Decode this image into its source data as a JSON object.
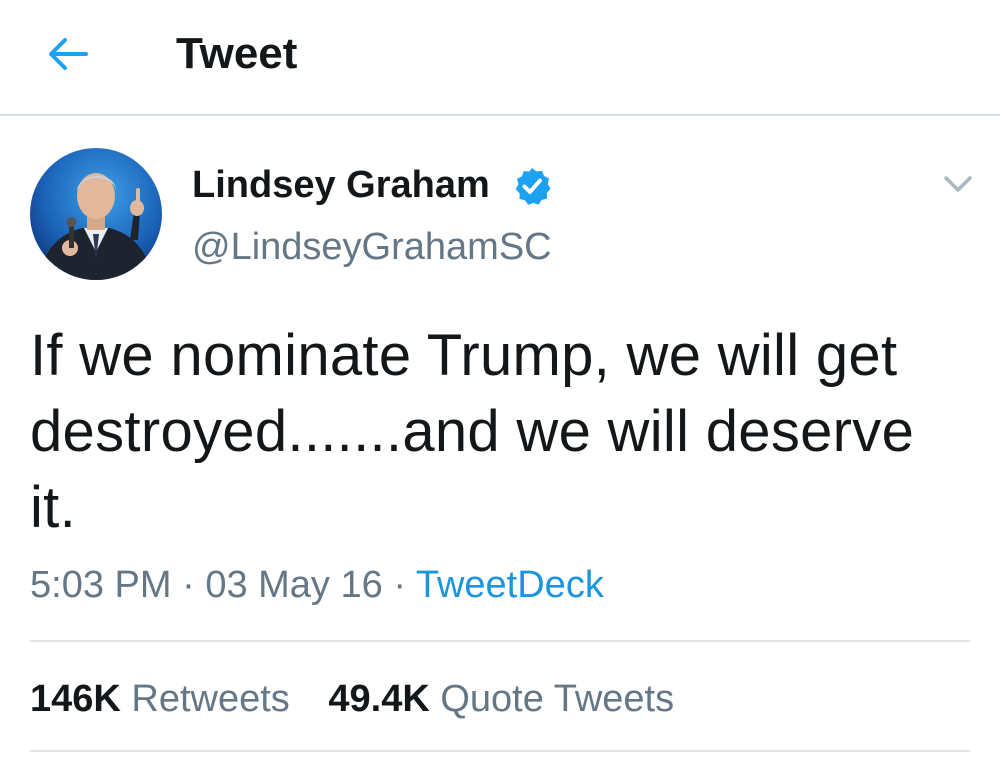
{
  "header": {
    "title": "Tweet",
    "back_icon": "arrow-left-icon",
    "accent": "#1da1f2"
  },
  "tweet": {
    "author": {
      "name": "Lindsey Graham",
      "handle": "@LindseyGrahamSC",
      "verified": true,
      "avatar_icon": "profile-photo"
    },
    "text": "If we nominate Trump, we will get destroyed.......and we will deserve it.",
    "time": "5:03 PM",
    "date": "03 May 16",
    "separator": "·",
    "source": "TweetDeck",
    "menu_icon": "chevron-down-icon"
  },
  "stats": {
    "retweets_count": "146K",
    "retweets_label": "Retweets",
    "quotes_count": "49.4K",
    "quotes_label": "Quote Tweets"
  },
  "colors": {
    "text": "#14171a",
    "secondary": "#657786",
    "link": "#1b95e0",
    "divider": "#dfe4e8"
  }
}
